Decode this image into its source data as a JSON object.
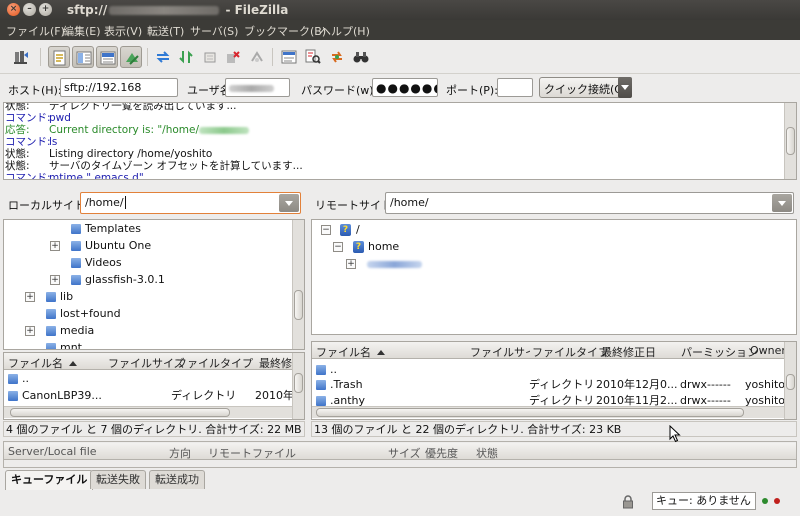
{
  "window": {
    "title_prefix": "sftp://",
    "title_suffix": " - FileZilla"
  },
  "menu": [
    "ファイル(F)",
    "編集(E)",
    "表示(V)",
    "転送(T)",
    "サーバ(S)",
    "ブックマーク(B)",
    "ヘルプ(H)"
  ],
  "quickconnect": {
    "host_label": "ホスト(H):",
    "host_value": "sftp://192.168",
    "user_label": "ユーザ名(U):",
    "password_label": "パスワード(w):",
    "password_value": "●●●●●●",
    "port_label": "ポート(P):",
    "port_value": "",
    "connect_button": "クイック接続(Q)"
  },
  "log": [
    {
      "type": "状態:",
      "message": "ディレクトリ一覧を読み出しています...",
      "kind": "status"
    },
    {
      "type": "コマンド:",
      "message": "pwd",
      "kind": "cmd"
    },
    {
      "type": "応答:",
      "message": "Current directory is: \"/home/",
      "kind": "resp"
    },
    {
      "type": "コマンド:",
      "message": "ls",
      "kind": "cmd"
    },
    {
      "type": "状態:",
      "message": "Listing directory /home/yoshito",
      "kind": "status"
    },
    {
      "type": "状態:",
      "message": "サーバのタイムゾーン オフセットを計算しています...",
      "kind": "status"
    },
    {
      "type": "コマンド:",
      "message": "mtime \".emacs.d\"",
      "kind": "cmd"
    }
  ],
  "local": {
    "site_label": "ローカルサイト:",
    "path": "/home/",
    "tree": [
      {
        "name": "Templates",
        "expander": ""
      },
      {
        "name": "Ubuntu One",
        "expander": "+"
      },
      {
        "name": "Videos",
        "expander": ""
      },
      {
        "name": "glassfish-3.0.1",
        "expander": "+"
      },
      {
        "name": "lib",
        "expander": "+"
      },
      {
        "name": "lost+found",
        "expander": ""
      },
      {
        "name": "media",
        "expander": "+"
      },
      {
        "name": "mnt",
        "expander": ""
      }
    ],
    "columns": [
      "ファイル名",
      "ファイルサイズ",
      "ファイルタイプ",
      "最終修正"
    ],
    "rows": [
      {
        "name": "..",
        "size": "",
        "type": "",
        "modified": ""
      },
      {
        "name": "CanonLBP39...",
        "size": "",
        "type": "ディレクトリ",
        "modified": "2010年"
      }
    ],
    "status": "4 個のファイル と 7 個のディレクトリ. 合計サイズ: 22 MB"
  },
  "remote": {
    "site_label": "リモートサイト:",
    "path": "/home/",
    "tree": [
      {
        "name": "/",
        "expander": "−"
      },
      {
        "name": "home",
        "expander": "−"
      },
      {
        "name": "",
        "expander": "+"
      }
    ],
    "columns": [
      "ファイル名",
      "ファイルサイズ",
      "ファイルタイプ",
      "最終修正日",
      "パーミッション",
      "Owner/G"
    ],
    "rows": [
      {
        "name": "..",
        "size": "",
        "type": "",
        "modified": "",
        "perm": "",
        "owner": ""
      },
      {
        "name": ".Trash",
        "size": "",
        "type": "ディレクトリ",
        "modified": "2010年12月0...",
        "perm": "drwx------",
        "owner": "yoshito"
      },
      {
        "name": ".anthy",
        "size": "",
        "type": "ディレクトリ",
        "modified": "2010年11月2...",
        "perm": "drwx------",
        "owner": "yoshito"
      }
    ],
    "status": "13 個のファイル と 22 個のディレクトリ. 合計サイズ: 23 KB"
  },
  "queue": {
    "columns": [
      "Server/Local file",
      "方向",
      "リモートファイル",
      "サイズ",
      "優先度",
      "状態"
    ]
  },
  "tabs": [
    "キューファイル",
    "転送失敗",
    "転送成功"
  ],
  "statusbar": {
    "queue_text": "キュー: ありません"
  },
  "colors": {
    "titlebar": "#3c3b37",
    "accent_orange": "#e2813a",
    "log_command": "#2020b0",
    "log_response": "#2a8a2a"
  }
}
